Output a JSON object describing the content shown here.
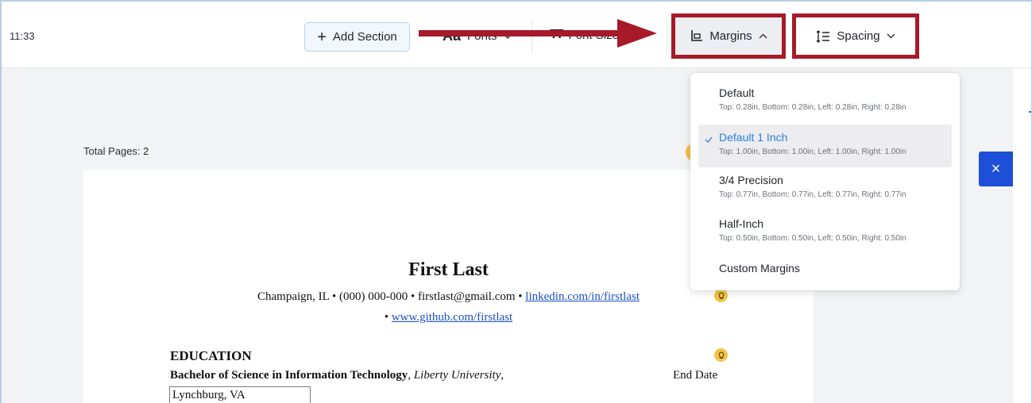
{
  "status": {
    "time": "11:33"
  },
  "toolbar": {
    "add_section_label": "Add Section",
    "fonts_label": "Fonts",
    "fonts_glyph": "Aa",
    "font_size_label": "Font Size",
    "font_size_glyph": "TT",
    "margins_label": "Margins",
    "spacing_label": "Spacing"
  },
  "colors": {
    "highlight_border": "#a71a2a",
    "selected_text": "#2a7de1",
    "close_button": "#1d4fd7",
    "bulb": "#f3c24a"
  },
  "document": {
    "total_pages": "Total Pages: 2",
    "name": "First Last",
    "contact_text": "Champaign, IL • (000) 000-000 • firstlast@gmail.com • ",
    "linkedin": "linkedin.com/in/firstlast",
    "contact_bullet": "• ",
    "github": "www.github.com/firstlast",
    "education_heading": "EDUCATION",
    "degree": "Bachelor of Science in Information Technology",
    "degree_sep": ", ",
    "university": "Liberty University",
    "university_sep": ",",
    "end_date": "End Date",
    "location": "Lynchburg, VA"
  },
  "margins_menu": {
    "items": [
      {
        "title": "Default",
        "detail": "Top: 0.28in, Bottom: 0.28in, Left: 0.28in, Right: 0.28in",
        "selected": false
      },
      {
        "title": "Default 1 Inch",
        "detail": "Top: 1.00in, Bottom: 1.00in, Left: 1.00in, Right: 1.00in",
        "selected": true
      },
      {
        "title": "3/4 Precision",
        "detail": "Top: 0.77in, Bottom: 0.77in, Left: 0.77in, Right: 0.77in",
        "selected": false
      },
      {
        "title": "Half-Inch",
        "detail": "Top: 0.50in, Bottom: 0.50in, Left: 0.50in, Right: 0.50in",
        "selected": false
      },
      {
        "title": "Custom Margins",
        "detail": "",
        "selected": false
      }
    ]
  },
  "icons": {
    "close": "×"
  }
}
